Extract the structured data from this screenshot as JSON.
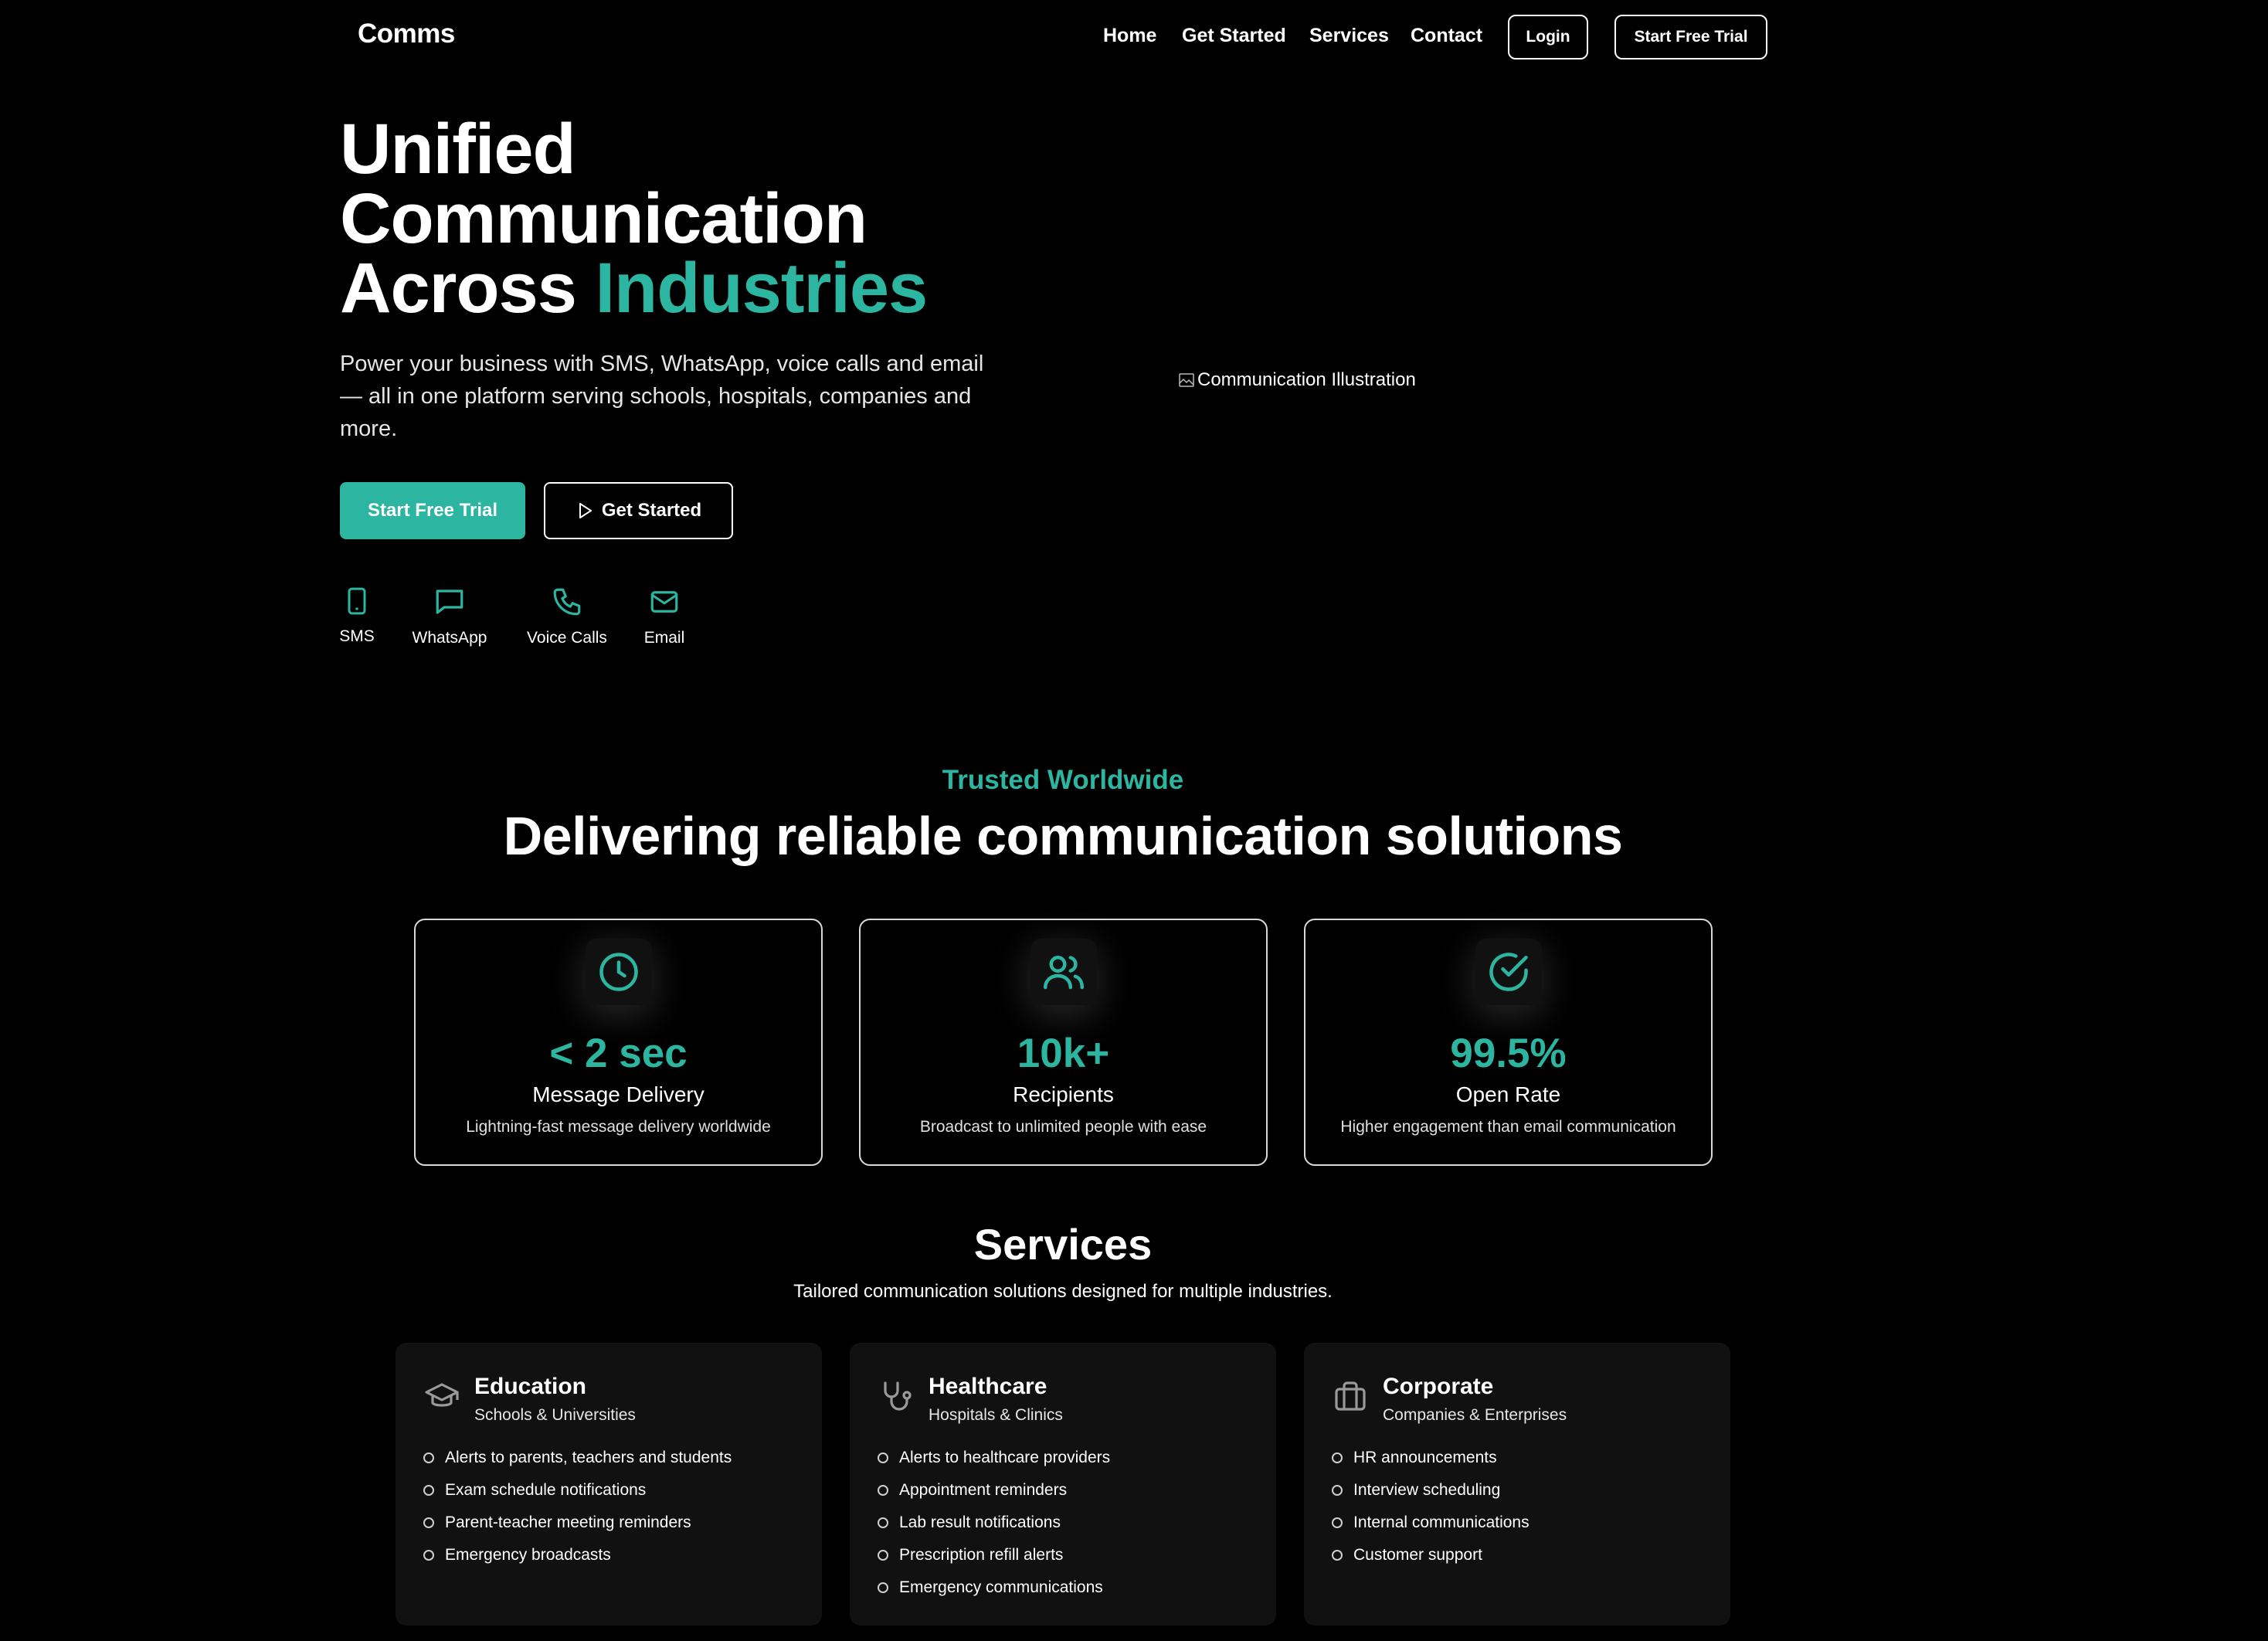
{
  "brand": "Comms",
  "nav": {
    "links": [
      "Home",
      "Get Started",
      "Services",
      "Contact"
    ],
    "login": "Login",
    "trial": "Start Free Trial"
  },
  "hero": {
    "title_line1": "Unified",
    "title_line2": "Communication",
    "title_line3a": "Across ",
    "title_line3b": "Industries",
    "subtitle": "Power your business with SMS, WhatsApp, voice calls and email — all in one platform serving schools, hospitals, companies and more.",
    "cta_primary": "Start Free Trial",
    "cta_secondary": "Get Started",
    "channels": [
      {
        "icon": "phone-icon",
        "label": "SMS"
      },
      {
        "icon": "chat-icon",
        "label": "WhatsApp"
      },
      {
        "icon": "call-icon",
        "label": "Voice Calls"
      },
      {
        "icon": "mail-icon",
        "label": "Email"
      }
    ],
    "image_alt": "Communication Illustration"
  },
  "trusted": {
    "eyebrow": "Trusted Worldwide",
    "title": "Delivering reliable communication solutions",
    "stats": [
      {
        "icon": "clock-icon",
        "value": "< 2 sec",
        "title": "Message Delivery",
        "desc": "Lightning-fast message delivery worldwide"
      },
      {
        "icon": "users-icon",
        "value": "10k+",
        "title": "Recipients",
        "desc": "Broadcast to unlimited people with ease"
      },
      {
        "icon": "check-circle-icon",
        "value": "99.5%",
        "title": "Open Rate",
        "desc": "Higher engagement than email communication"
      }
    ]
  },
  "services": {
    "title": "Services",
    "subtitle": "Tailored communication solutions designed for multiple industries.",
    "items": [
      {
        "icon": "graduation-cap-icon",
        "name": "Education",
        "type": "Schools & Universities",
        "features": [
          "Alerts to parents, teachers and students",
          "Exam schedule notifications",
          "Parent-teacher meeting reminders",
          "Emergency broadcasts"
        ]
      },
      {
        "icon": "stethoscope-icon",
        "name": "Healthcare",
        "type": "Hospitals & Clinics",
        "features": [
          "Alerts to healthcare providers",
          "Appointment reminders",
          "Lab result notifications",
          "Prescription refill alerts",
          "Emergency communications"
        ]
      },
      {
        "icon": "briefcase-icon",
        "name": "Corporate",
        "type": "Companies & Enterprises",
        "features": [
          "HR announcements",
          "Interview scheduling",
          "Internal communications",
          "Customer support"
        ]
      }
    ]
  },
  "colors": {
    "accent": "#2cb5a0",
    "background": "#000000",
    "card": "#111111"
  }
}
